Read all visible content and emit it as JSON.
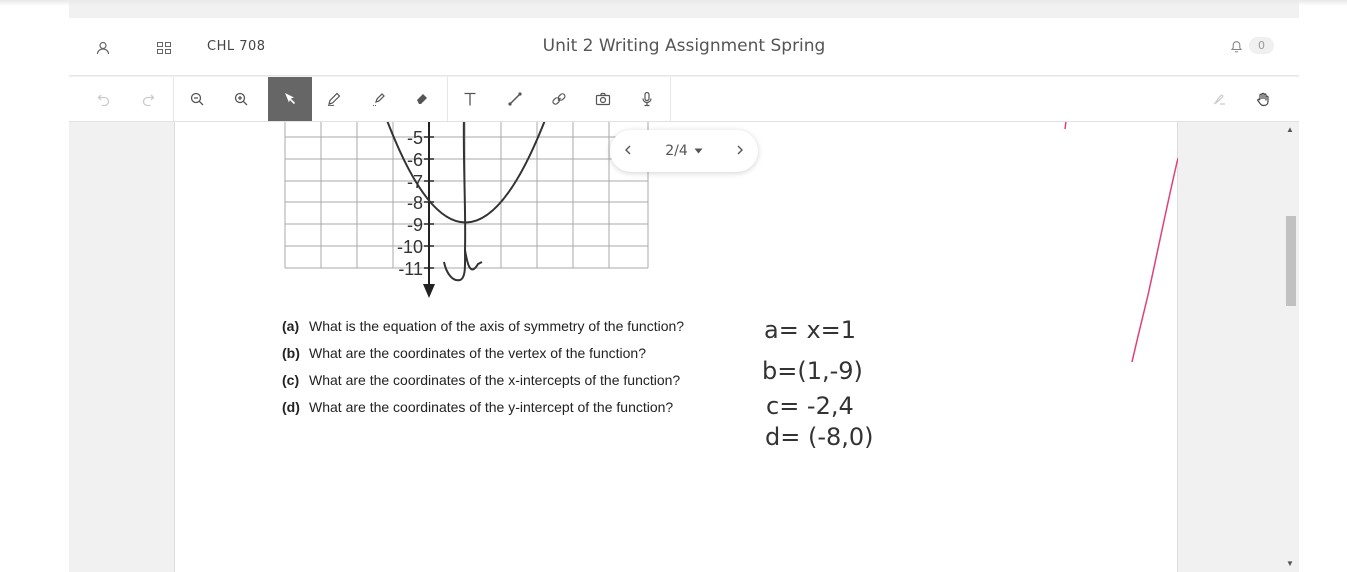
{
  "header": {
    "course": "CHL 708",
    "title": "Unit 2 Writing Assignment Spring",
    "notification_count": "0"
  },
  "pager": {
    "label": "2/4"
  },
  "graph": {
    "y_ticks": [
      "-5",
      "-6",
      "-7",
      "-8",
      "-9",
      "-10",
      "-11"
    ]
  },
  "questions": [
    {
      "letter": "(a)",
      "text": "What is the equation of the axis of symmetry of the function?"
    },
    {
      "letter": "(b)",
      "text": "What are the coordinates of the vertex of the function?"
    },
    {
      "letter": "(c)",
      "text": "What are the coordinates of the x-intercepts of the function?"
    },
    {
      "letter": "(d)",
      "text": "What are the coordinates of the y-intercept of the function?"
    }
  ],
  "answers": {
    "a": "a= x=1",
    "b": "b=(1,-9)",
    "c": "c= -2,4",
    "d": "d= (-8,0)"
  },
  "colors": {
    "ink": "#e0407a",
    "active_tool": "#666666"
  }
}
